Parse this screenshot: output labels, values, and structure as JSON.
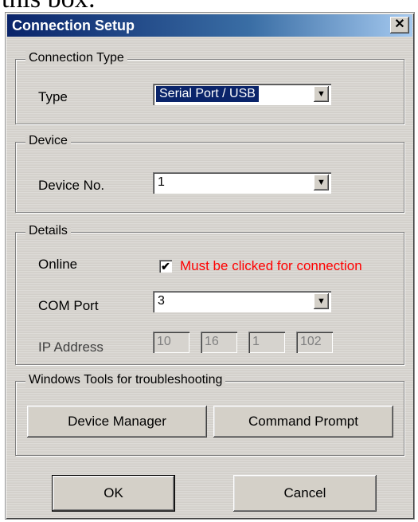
{
  "page_text": "this box:",
  "dialog": {
    "title": "Connection Setup",
    "close_glyph": "✕"
  },
  "connection_type": {
    "legend": "Connection Type",
    "type_label": "Type",
    "type_value": "Serial Port / USB"
  },
  "device": {
    "legend": "Device",
    "device_no_label": "Device No.",
    "device_no_value": "1"
  },
  "details": {
    "legend": "Details",
    "online_label": "Online",
    "online_checked": true,
    "online_mark": "✔",
    "online_note": "Must be clicked for connection",
    "com_port_label": "COM Port",
    "com_port_value": "3",
    "ip_label": "IP Address",
    "ip": [
      "10",
      "16",
      "1",
      "102"
    ]
  },
  "tools": {
    "legend": "Windows Tools for troubleshooting",
    "device_manager": "Device Manager",
    "command_prompt": "Command Prompt"
  },
  "footer": {
    "ok": "OK",
    "cancel": "Cancel"
  },
  "icons": {
    "dropdown": "▼"
  },
  "colors": {
    "title_bar": "#0a246a",
    "note": "#ff0000",
    "dialog_bg": "#d6d3ce"
  }
}
